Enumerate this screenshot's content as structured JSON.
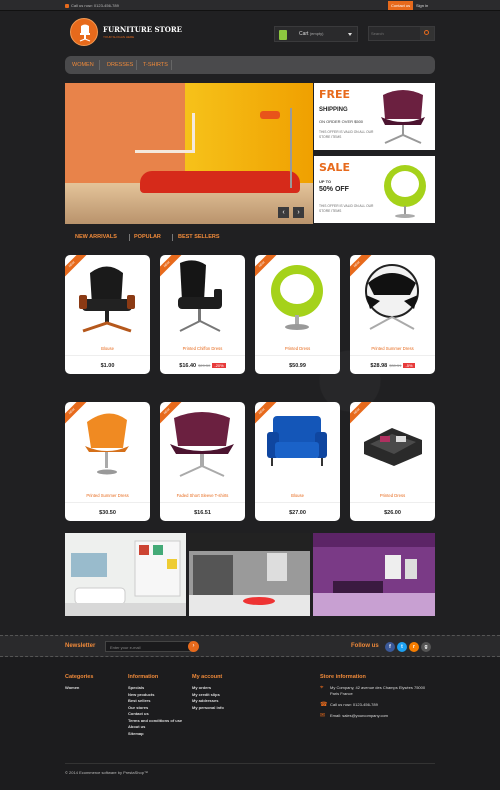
{
  "topbar": {
    "call": "Call us now: 0123-456-789",
    "contact": "Contact us",
    "signin": "Sign in"
  },
  "logo": {
    "title": "FURNITURE STORE",
    "tagline": "YOUR SLOGAN HERE"
  },
  "cart": {
    "label": "Cart",
    "status": "(empty)"
  },
  "search": {
    "placeholder": "Search"
  },
  "nav": [
    "WOMEN",
    "DRESSES",
    "T-SHIRTS"
  ],
  "promos": [
    {
      "big": "FREE",
      "sub": "SHIPPING",
      "line": "ON ORDER OVER $500",
      "note": "THIS OFFER IS VALID ON ALL OUR STORE ITEMS"
    },
    {
      "big": "SALE",
      "sub": "UP TO",
      "line": "50% OFF",
      "note": "THIS OFFER IS VALID ON ALL OUR STORE ITEMS"
    }
  ],
  "tabs": [
    "NEW ARRIVALS",
    "POPULAR",
    "BEST SELLERS"
  ],
  "ribbon": "NEW",
  "products": [
    {
      "name": "Blouse",
      "price": "$1.00",
      "old": "",
      "discount": ""
    },
    {
      "name": "Printed Chiffon Dress",
      "price": "$16.40",
      "old": "$20.50",
      "discount": "-20%"
    },
    {
      "name": "Printed Dress",
      "price": "$50.99",
      "old": "",
      "discount": ""
    },
    {
      "name": "Printed Summer Dress",
      "price": "$28.98",
      "old": "$30.51",
      "discount": "-5%"
    },
    {
      "name": "Printed Summer Dress",
      "price": "$30.50",
      "old": "",
      "discount": ""
    },
    {
      "name": "Faded Short Sleeve T-shirts",
      "price": "$16.51",
      "old": "",
      "discount": ""
    },
    {
      "name": "Blouse",
      "price": "$27.00",
      "old": "",
      "discount": ""
    },
    {
      "name": "Printed Dress",
      "price": "$26.00",
      "old": "",
      "discount": ""
    }
  ],
  "newsletter": {
    "label": "Newsletter",
    "placeholder": "Enter your e-mail",
    "follow": "Follow us"
  },
  "footer": {
    "categories": {
      "heading": "Categories",
      "items": [
        "Women"
      ]
    },
    "information": {
      "heading": "Information",
      "items": [
        "Specials",
        "New products",
        "Best sellers",
        "Our stores",
        "Contact us",
        "Terms and conditions of use",
        "About us",
        "Sitemap"
      ]
    },
    "account": {
      "heading": "My account",
      "items": [
        "My orders",
        "My credit slips",
        "My addresses",
        "My personal info"
      ]
    },
    "store": {
      "heading": "Store information",
      "address": "My Company, 42 avenue des Champs Elysées 75000 Paris France",
      "phone": "Call us now: 0123-456-789",
      "email": "Email: sales@yourcompany.com"
    },
    "copyright": "© 2014 Ecommerce software by PrestaShop™"
  },
  "colors": {
    "accent": "#e76a1c",
    "background": "#1e1e20"
  }
}
